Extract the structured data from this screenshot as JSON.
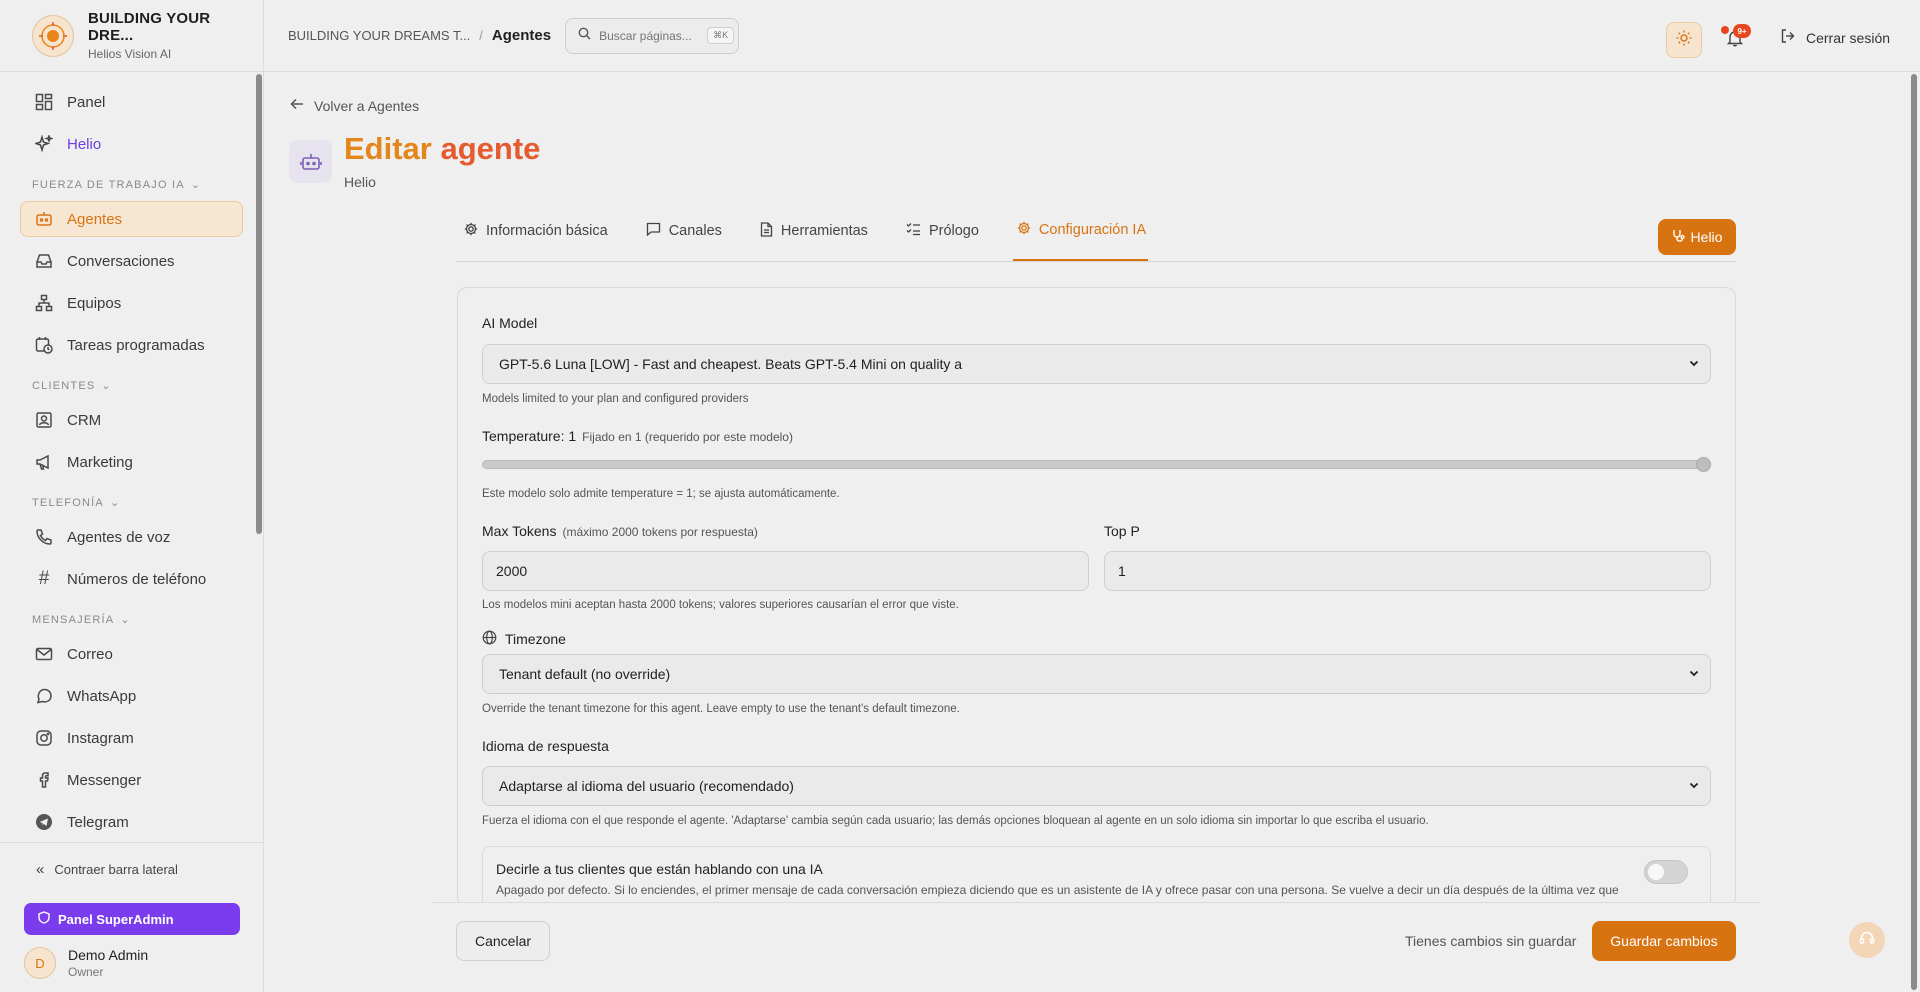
{
  "brand": {
    "name": "BUILDING YOUR DRE...",
    "subtitle": "Helios Vision AI"
  },
  "sidebar": {
    "items_top": [
      {
        "label": "Panel",
        "icon": "dashboard-icon"
      },
      {
        "label": "Helio",
        "icon": "sparkles-icon"
      }
    ],
    "section_workforce": "FUERZA DE TRABAJO IA",
    "items_workforce": [
      {
        "label": "Agentes",
        "icon": "bot-icon"
      },
      {
        "label": "Conversaciones",
        "icon": "inbox-icon"
      },
      {
        "label": "Equipos",
        "icon": "org-chart-icon"
      },
      {
        "label": "Tareas programadas",
        "icon": "calendar-clock-icon"
      }
    ],
    "section_clients": "CLIENTES",
    "items_clients": [
      {
        "label": "CRM",
        "icon": "contact-icon"
      },
      {
        "label": "Marketing",
        "icon": "megaphone-icon"
      }
    ],
    "section_phone": "TELEFONÍA",
    "items_phone": [
      {
        "label": "Agentes de voz",
        "icon": "phone-icon"
      },
      {
        "label": "Números de teléfono",
        "icon": "hash-icon"
      }
    ],
    "section_messaging": "MENSAJERÍA",
    "items_messaging": [
      {
        "label": "Correo",
        "icon": "mail-icon"
      },
      {
        "label": "WhatsApp",
        "icon": "whatsapp-icon"
      },
      {
        "label": "Instagram",
        "icon": "instagram-icon"
      },
      {
        "label": "Messenger",
        "icon": "facebook-icon"
      },
      {
        "label": "Telegram",
        "icon": "telegram-icon"
      }
    ],
    "collapse_label": "Contraer barra lateral",
    "superadmin_label": "Panel SuperAdmin",
    "user": {
      "initial": "D",
      "name": "Demo Admin",
      "role": "Owner"
    }
  },
  "topbar": {
    "breadcrumb_parent": "BUILDING YOUR DREAMS T...",
    "breadcrumb_current": "Agentes",
    "search_placeholder": "Buscar páginas...",
    "search_shortcut": "⌘K",
    "notifications_badge": "9+",
    "logout_label": "Cerrar sesión"
  },
  "page": {
    "back_label": "Volver a Agentes",
    "title_part1": "Editar",
    "title_part2": "agente",
    "subtitle": "Helio"
  },
  "tabs": [
    {
      "label": "Información básica",
      "icon": "gear-icon"
    },
    {
      "label": "Canales",
      "icon": "chat-icon"
    },
    {
      "label": "Herramientas",
      "icon": "file-icon"
    },
    {
      "label": "Prólogo",
      "icon": "checklist-icon"
    },
    {
      "label": "Configuración IA",
      "icon": "gear-icon",
      "active": true
    }
  ],
  "helio_button_label": "Helio",
  "form": {
    "model_label": "AI Model",
    "model_value": "GPT-5.6 Luna [LOW] - Fast and cheapest. Beats GPT-5.4 Mini on quality a",
    "model_help": "Models limited to your plan and configured providers",
    "temperature_label": "Temperature: 1",
    "temperature_note": "Fijado en 1 (requerido por este modelo)",
    "temperature_fraction": 1.0,
    "temperature_help": "Este modelo solo admite temperature = 1; se ajusta automáticamente.",
    "max_tokens_label": "Max Tokens",
    "max_tokens_note": "(máximo 2000 tokens por respuesta)",
    "max_tokens_value": "2000",
    "top_p_label": "Top P",
    "top_p_value": "1",
    "tokens_help": "Los modelos mini aceptan hasta 2000 tokens; valores superiores causarían el error que viste.",
    "timezone_label": "Timezone",
    "timezone_value": "Tenant default (no override)",
    "timezone_help": "Override the tenant timezone for this agent. Leave empty to use the tenant's default timezone.",
    "language_label": "Idioma de respuesta",
    "language_value": "Adaptarse al idioma del usuario (recomendado)",
    "language_help": "Fuerza el idioma con el que responde el agente. 'Adaptarse' cambia según cada usuario; las demás opciones bloquean al agente en un solo idioma sin importar lo que escriba el usuario.",
    "ai_disclosure_title": "Decirle a tus clientes que están hablando con una IA",
    "ai_disclosure_desc": "Apagado por defecto. Si lo enciendes, el primer mensaje de cada conversación empieza diciendo que es un asistente de IA y ofrece pasar con una persona. Se vuelve a decir un día después de la última vez que"
  },
  "footer": {
    "cancel_label": "Cancelar",
    "unsaved_label": "Tienes cambios sin guardar",
    "save_label": "Guardar cambios"
  },
  "colors": {
    "accent": "#d87312",
    "superadmin": "#7a3cec",
    "title_gradient_end": "#e55a2e"
  }
}
